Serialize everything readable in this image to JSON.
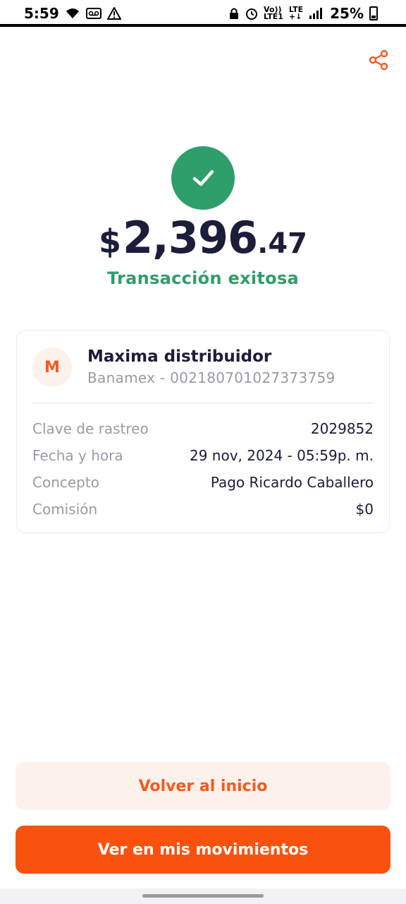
{
  "status_bar": {
    "time": "5:59",
    "network_top": "Vo))",
    "network_bottom": "LTE1",
    "lte_top": "LTE",
    "lte_bottom": "+↓",
    "battery": "25%"
  },
  "transaction": {
    "currency_symbol": "$",
    "amount_integer": "2,396",
    "amount_decimal": ".47",
    "status": "Transacción exitosa"
  },
  "recipient": {
    "initial": "M",
    "name": "Maxima distribuidor",
    "account": "Banamex - 002180701027373759"
  },
  "details": [
    {
      "label": "Clave de rastreo",
      "value": "2029852"
    },
    {
      "label": "Fecha y hora",
      "value": "29 nov, 2024 - 05:59p. m."
    },
    {
      "label": "Concepto",
      "value": "Pago Ricardo Caballero"
    },
    {
      "label": "Comisión",
      "value": "$0"
    }
  ],
  "actions": {
    "back_home": "Volver al inicio",
    "view_movements": "Ver en mis movimientos"
  },
  "icons": {
    "share": "share-icon",
    "success": "check-icon"
  },
  "colors": {
    "accent": "#f9520f",
    "success": "#2e9e6a",
    "accent_soft": "#fdf1ec",
    "text_dark": "#1b1d3a",
    "text_muted": "#9a9aa5"
  }
}
